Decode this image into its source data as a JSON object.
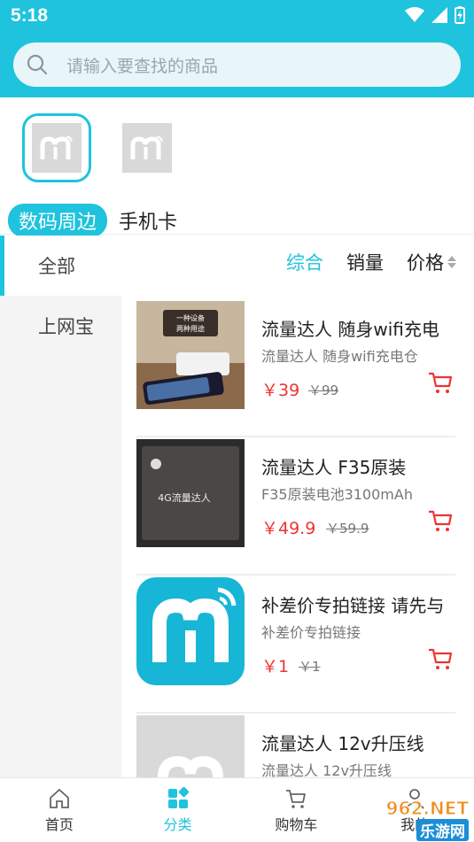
{
  "status": {
    "time": "5:18"
  },
  "search": {
    "placeholder": "请输入要查找的商品"
  },
  "categories": [
    {
      "label": "数码周边",
      "active": true
    },
    {
      "label": "手机卡",
      "active": false
    }
  ],
  "sidebar": {
    "items": [
      {
        "label": "全部",
        "active": true
      },
      {
        "label": "上网宝",
        "active": false
      }
    ]
  },
  "sort": {
    "options": [
      "综合",
      "销量",
      "价格"
    ]
  },
  "products": [
    {
      "name": "流量达人 随身wifi充电",
      "sub": "流量达人 随身wifi充电仓",
      "price": "￥39",
      "orig": "￥99"
    },
    {
      "name": "流量达人 F35原装",
      "sub": "F35原装电池3100mAh",
      "price": "￥49.9",
      "orig": "￥59.9"
    },
    {
      "name": "补差价专拍链接 请先与",
      "sub": "补差价专拍链接",
      "price": "￥1",
      "orig": "￥1"
    },
    {
      "name": "流量达人 12v升压线",
      "sub": "流量达人 12v升压线",
      "price": "",
      "orig": ""
    }
  ],
  "thumb_text": {
    "line1": "一种设备",
    "line2": "两种用途",
    "box_label": "4G流量达人"
  },
  "tabs": [
    "首页",
    "分类",
    "购物车",
    "我的"
  ],
  "watermark": {
    "top": "962.NET",
    "bottom": "乐游网"
  },
  "colors": {
    "accent": "#1fc3dd",
    "price": "#e33333"
  }
}
